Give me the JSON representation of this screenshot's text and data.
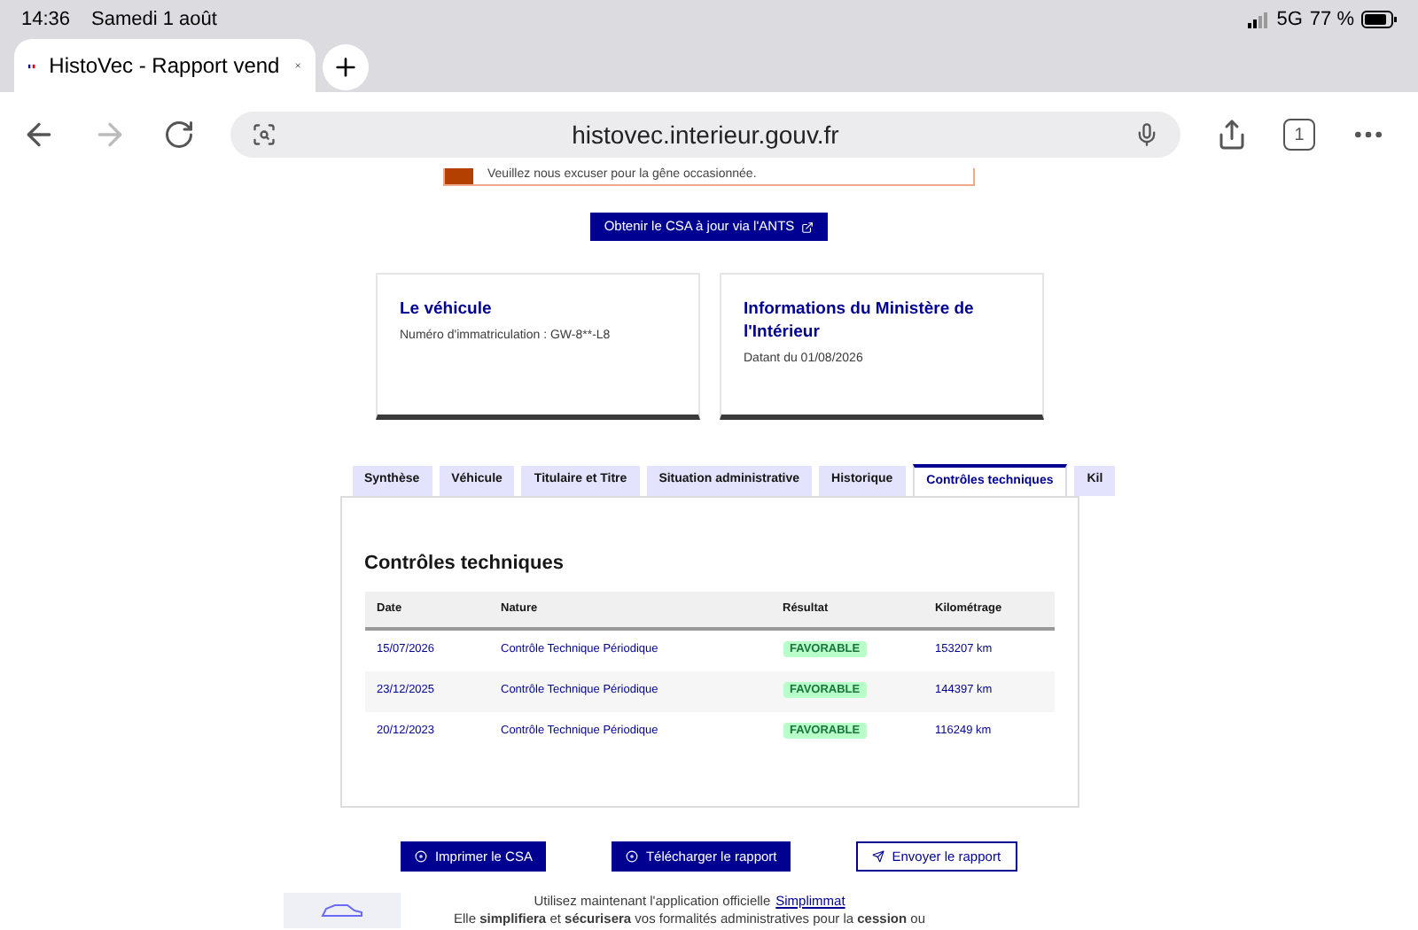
{
  "status_bar": {
    "time": "14:36",
    "date": "Samedi 1 août",
    "network": "5G",
    "battery": "77 %"
  },
  "browser": {
    "tab_title": "HistoVec - Rapport vend",
    "url": "histovec.interieur.gouv.fr",
    "tab_count": "1"
  },
  "alert": {
    "text": "Veuillez nous excuser pour la gêne occasionnée."
  },
  "csa_button": "Obtenir le CSA à jour via l'ANTS",
  "cards": [
    {
      "title": "Le véhicule",
      "text": "Numéro d'immatriculation : GW-8**-L8"
    },
    {
      "title": "Informations du Ministère de l'Intérieur",
      "text": "Datant du 01/08/2026"
    }
  ],
  "tabs": [
    {
      "label": "Synthèse",
      "selected": false
    },
    {
      "label": "Véhicule",
      "selected": false
    },
    {
      "label": "Titulaire et Titre",
      "selected": false
    },
    {
      "label": "Situation administrative",
      "selected": false
    },
    {
      "label": "Historique",
      "selected": false
    },
    {
      "label": "Contrôles techniques",
      "selected": true
    },
    {
      "label": "Kil",
      "selected": false
    }
  ],
  "section_title": "Contrôles techniques",
  "table": {
    "columns": [
      "Date",
      "Nature",
      "Résultat",
      "Kilométrage"
    ],
    "rows": [
      [
        "15/07/2026",
        "Contrôle Technique Périodique",
        "FAVORABLE",
        "153207 km"
      ],
      [
        "23/12/2025",
        "Contrôle Technique Périodique",
        "FAVORABLE",
        "144397 km"
      ],
      [
        "20/12/2023",
        "Contrôle Technique Périodique",
        "FAVORABLE",
        "116249 km"
      ]
    ]
  },
  "actions": [
    {
      "label": "Imprimer le CSA",
      "kind": "primary"
    },
    {
      "label": "Télécharger le rapport",
      "kind": "primary"
    },
    {
      "label": "Envoyer le rapport",
      "kind": "secondary"
    }
  ],
  "promo": {
    "line1": "Utilisez maintenant l'application officielle",
    "link": "Simplimmat",
    "line2": "Elle **simplifiera** et **sécurisera** vos formalités administratives pour la **cession** ou"
  }
}
